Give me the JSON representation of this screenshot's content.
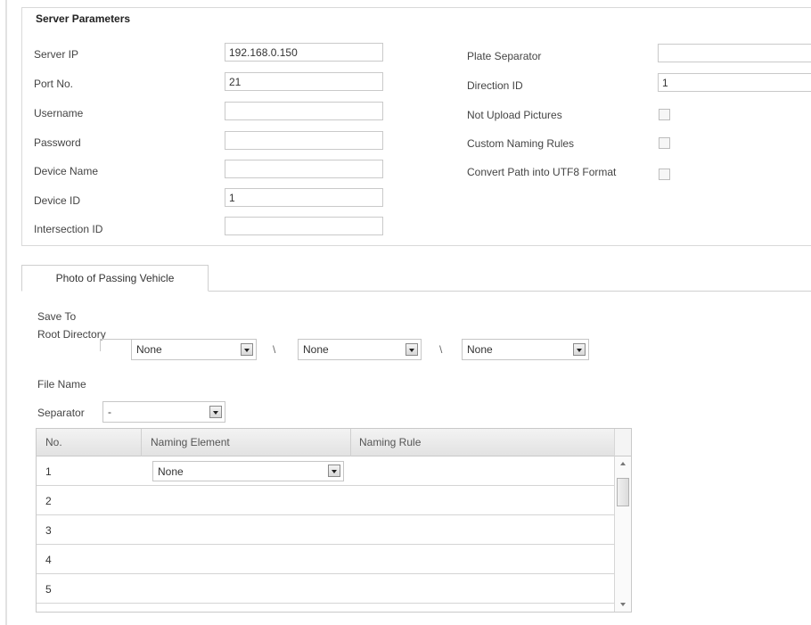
{
  "server_parameters": {
    "title": "Server Parameters",
    "server_ip": {
      "label": "Server IP",
      "value": "192.168.0.150"
    },
    "port_no": {
      "label": "Port No.",
      "value": "21"
    },
    "username": {
      "label": "Username",
      "value": ""
    },
    "password": {
      "label": "Password",
      "value": ""
    },
    "device_name": {
      "label": "Device Name",
      "value": ""
    },
    "device_id": {
      "label": "Device ID",
      "value": "1"
    },
    "intersection_id": {
      "label": "Intersection ID",
      "value": ""
    },
    "plate_separator": {
      "label": "Plate Separator",
      "value": ""
    },
    "direction_id": {
      "label": "Direction ID",
      "value": "1"
    },
    "not_upload_pictures": {
      "label": "Not Upload Pictures",
      "checked": false
    },
    "custom_naming_rules": {
      "label": "Custom Naming Rules",
      "checked": false
    },
    "convert_path_utf8": {
      "label": "Convert Path into UTF8 Format",
      "checked": false
    }
  },
  "tabs": [
    {
      "label": "Photo of Passing Vehicle",
      "active": true
    }
  ],
  "save_to": {
    "label": "Save To",
    "root_directory_label": "Root Directory",
    "directory_levels": [
      "None",
      "None",
      "None"
    ],
    "path_separator": "\\"
  },
  "file_name": {
    "label": "File Name",
    "separator_label": "Separator",
    "separator_value": "-"
  },
  "naming_table": {
    "columns": [
      "No.",
      "Naming Element",
      "Naming Rule"
    ],
    "rows": [
      {
        "no": "1",
        "element": "None",
        "rule": ""
      },
      {
        "no": "2",
        "element": "",
        "rule": ""
      },
      {
        "no": "3",
        "element": "",
        "rule": ""
      },
      {
        "no": "4",
        "element": "",
        "rule": ""
      },
      {
        "no": "5",
        "element": "",
        "rule": ""
      }
    ]
  },
  "icons": {
    "dropdown": "chevron-down-icon",
    "checkbox": "checkbox-icon",
    "scroll_up": "scroll-up-arrow-icon",
    "scroll_down": "scroll-down-arrow-icon"
  }
}
